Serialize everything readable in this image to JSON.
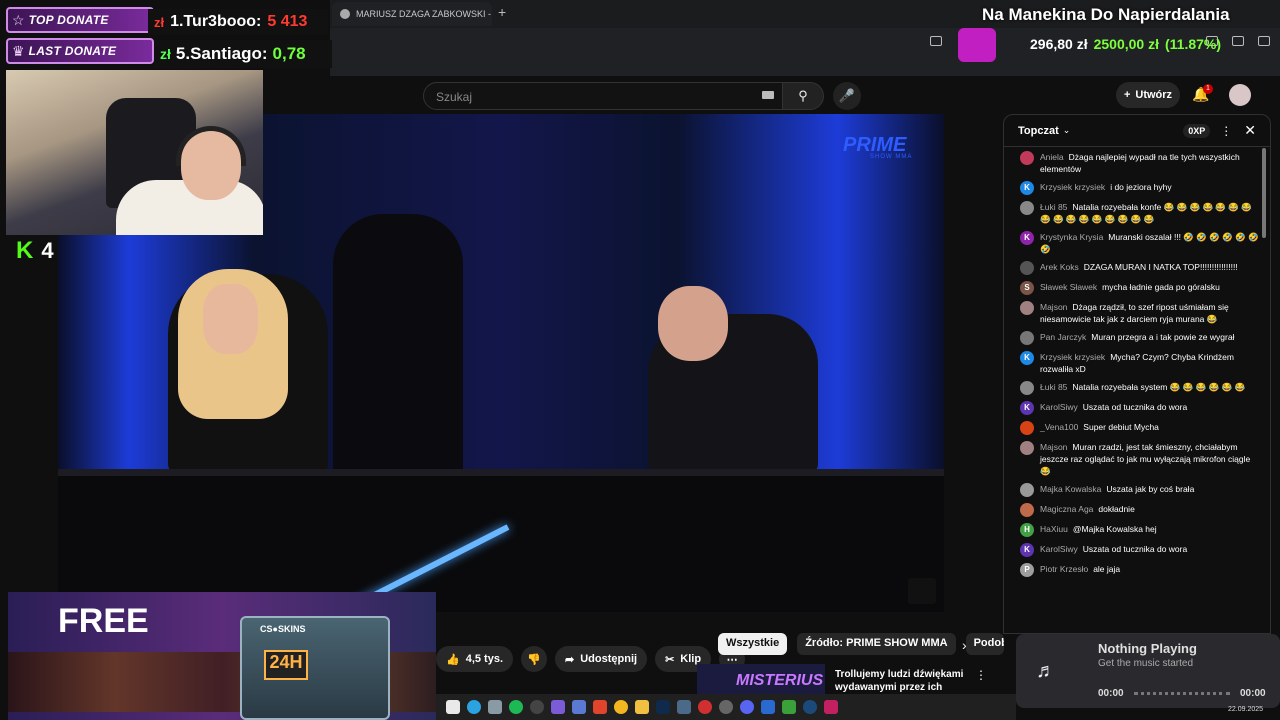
{
  "browser": {
    "tab_title": "MARIUSZ DZAGA ZABKOWSKI - Szuk...",
    "new_tab_symbol": "+"
  },
  "overlay": {
    "top_donate_label": "TOP DONATE",
    "last_donate_label": "LAST DONATE",
    "top_donor_currency": "zł",
    "top_donor_name": "1.Tur3booo:",
    "top_donor_amount": "5 413",
    "last_donor_currency": "zł",
    "last_donor_name": "5.Santiago:",
    "last_donor_amount": "0,78",
    "kick_logo": "K",
    "kick_viewers": "4",
    "stream_title": "Na Manekina Do Napierdalania",
    "stat_balance": "296,80 zł",
    "stat_target": "2500,00 zł",
    "stat_percent": "(11.87%)"
  },
  "youtube": {
    "search_placeholder": "Szukaj",
    "create_label": "Utwórz",
    "notification_count": "1",
    "video_brand": "PRIME",
    "video_brand_sub": "SHOW MMA",
    "actions": {
      "likes": "4,5 tys.",
      "share": "Udostępnij",
      "clip": "Klip"
    },
    "chips": [
      "Wszystkie",
      "Źródło: PRIME SHOW MMA",
      "Podob"
    ],
    "recommended": {
      "thumb_text": "MISTERIUS",
      "title": "Trollujemy ludzi dźwiękami wydawanymi przez ich własne"
    }
  },
  "chat": {
    "title": "Topczat",
    "xp": "0XP",
    "messages": [
      {
        "name": "Aniela",
        "text": "Dżaga najlepiej wypadł na tle tych wszystkich elementów",
        "color": "#c23a5a",
        "initial": ""
      },
      {
        "name": "Krzysiek krzysiek",
        "text": "i do jeziora hyhy",
        "color": "#1e88e5",
        "initial": "K"
      },
      {
        "name": "Łuki 85",
        "text": "Natalia rozyebała konfe 😂 😂 😂 😂 😂 😂 😂 😂 😂 😂 😂 😂 😂 😂 😂 😂",
        "color": "#888",
        "initial": ""
      },
      {
        "name": "Krystynka Krysia",
        "text": "Muranski oszalał !!! 🤣 🤣 🤣 🤣 🤣 🤣 🤣",
        "color": "#8e24aa",
        "initial": "K"
      },
      {
        "name": "Arek Koks",
        "text": "DZAGA MURAN I NATKA TOP!!!!!!!!!!!!!!!!",
        "color": "#555",
        "initial": ""
      },
      {
        "name": "Sławek Sławek",
        "text": "mycha ładnie gada po góralsku",
        "color": "#795548",
        "initial": "S"
      },
      {
        "name": "Majson",
        "text": "Dżaga rządził, to szef ripost uśmiałam się niesamowicie tak jak z darciem ryja murana 😂",
        "color": "#a08080",
        "initial": ""
      },
      {
        "name": "Pan Jarczyk",
        "text": "Muran przegra a i tak powie ze wygrał",
        "color": "#777",
        "initial": ""
      },
      {
        "name": "Krzysiek krzysiek",
        "text": "Mycha? Czym? Chyba Krindżem rozwaliła xD",
        "color": "#1e88e5",
        "initial": "K"
      },
      {
        "name": "Łuki 85",
        "text": "Natalia rozyebała system 😂 😂 😂 😂 😂 😂",
        "color": "#888",
        "initial": ""
      },
      {
        "name": "KarolSiwy",
        "text": "Uszata od tucznika do wora",
        "color": "#5e35b1",
        "initial": "K"
      },
      {
        "name": "_Vena100",
        "text": "Super debiut Mycha",
        "color": "#d84315",
        "initial": ""
      },
      {
        "name": "Majson",
        "text": "Muran rzadzi, jest tak śmieszny, chciałabym jeszcze raz oglądać to jak mu wyłączają mikrofon ciągle 😂",
        "color": "#a08080",
        "initial": ""
      },
      {
        "name": "Majka Kowalska",
        "text": "Uszata jak by coś brała",
        "color": "#999",
        "initial": ""
      },
      {
        "name": "Magiczna Aga",
        "text": "dokładnie",
        "color": "#bf6a4a",
        "initial": ""
      },
      {
        "name": "HaXiuu",
        "text": "@Majka Kowalska hej",
        "color": "#43a047",
        "initial": "H"
      },
      {
        "name": "KarolSiwy",
        "text": "Uszata od tucznika do wora",
        "color": "#5e35b1",
        "initial": "K"
      },
      {
        "name": "Piotr Krzesło",
        "text": "ale jaja",
        "color": "#9e9e9e",
        "initial": "P"
      }
    ]
  },
  "now_playing": {
    "title": "Nothing Playing",
    "subtitle": "Get the music started",
    "time_start": "00:00",
    "time_end": "00:00"
  },
  "taskbar": {
    "date": "22.09.2025"
  }
}
